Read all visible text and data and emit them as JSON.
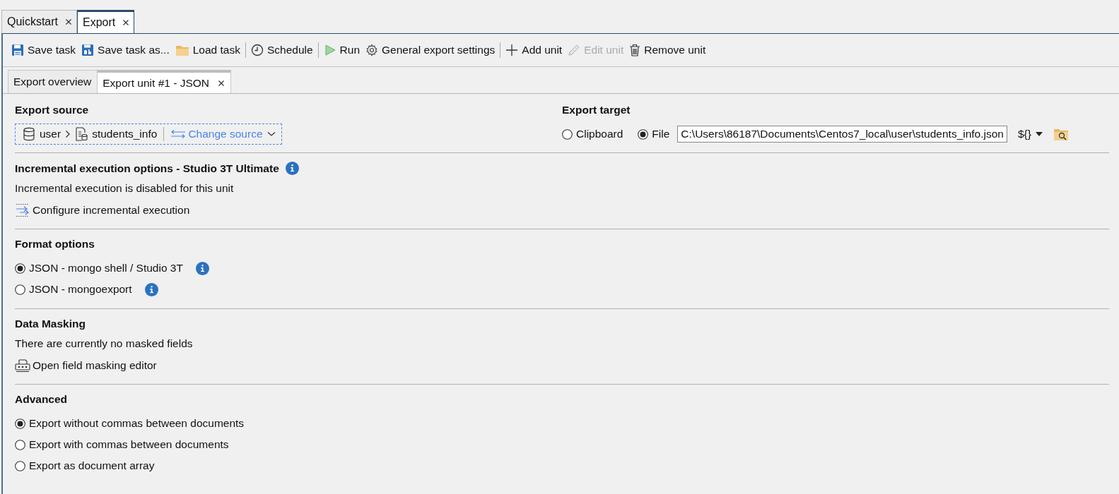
{
  "document_tabs": [
    {
      "label": "Quickstart",
      "selected": false
    },
    {
      "label": "Export",
      "selected": true
    }
  ],
  "toolbar": [
    {
      "kind": "button",
      "label": "Save task",
      "disabled": false
    },
    {
      "kind": "button",
      "label": "Save task as...",
      "disabled": false
    },
    {
      "kind": "button",
      "label": "Load task",
      "disabled": false
    },
    {
      "kind": "separator"
    },
    {
      "kind": "button",
      "label": "Schedule",
      "disabled": false
    },
    {
      "kind": "separator"
    },
    {
      "kind": "button",
      "label": "Run",
      "disabled": false
    },
    {
      "kind": "button",
      "label": "General export settings",
      "disabled": false
    },
    {
      "kind": "separator"
    },
    {
      "kind": "button",
      "label": "Add unit",
      "disabled": false
    },
    {
      "kind": "button",
      "label": "Edit unit",
      "disabled": true
    },
    {
      "kind": "button",
      "label": "Remove unit",
      "disabled": false
    }
  ],
  "unit_tabs": [
    {
      "label": "Export overview",
      "selected": false,
      "closable": false
    },
    {
      "label": "Export unit #1 - JSON",
      "selected": true,
      "closable": true
    }
  ],
  "export_source": {
    "title": "Export source",
    "database": "user",
    "collection": "students_info",
    "change_label": "Change source"
  },
  "export_target": {
    "title": "Export target",
    "options": [
      {
        "label": "Clipboard",
        "selected": false
      },
      {
        "label": "File",
        "selected": true
      }
    ],
    "path": "C:\\Users\\86187\\Documents\\Centos7_local\\user\\students_info.json",
    "variables_label": "${}"
  },
  "sections": [
    {
      "kind": "info-action",
      "title": "Incremental execution options - Studio 3T Ultimate",
      "text": "Incremental execution is disabled for this unit",
      "action": "Configure incremental execution"
    },
    {
      "kind": "radios",
      "title": "Format options",
      "options": [
        {
          "label": "JSON - mongo shell / Studio 3T",
          "selected": true,
          "info": true
        },
        {
          "label": "JSON - mongoexport",
          "selected": false,
          "info": true
        }
      ]
    },
    {
      "kind": "action",
      "title": "Data Masking",
      "text": "There are currently no masked fields",
      "action": "Open field masking editor"
    },
    {
      "kind": "radios",
      "title": "Advanced",
      "options": [
        {
          "label": "Export without commas between documents",
          "selected": true,
          "info": false
        },
        {
          "label": "Export with commas between documents",
          "selected": false,
          "info": false
        },
        {
          "label": "Export as document array",
          "selected": false,
          "info": false
        }
      ]
    }
  ]
}
